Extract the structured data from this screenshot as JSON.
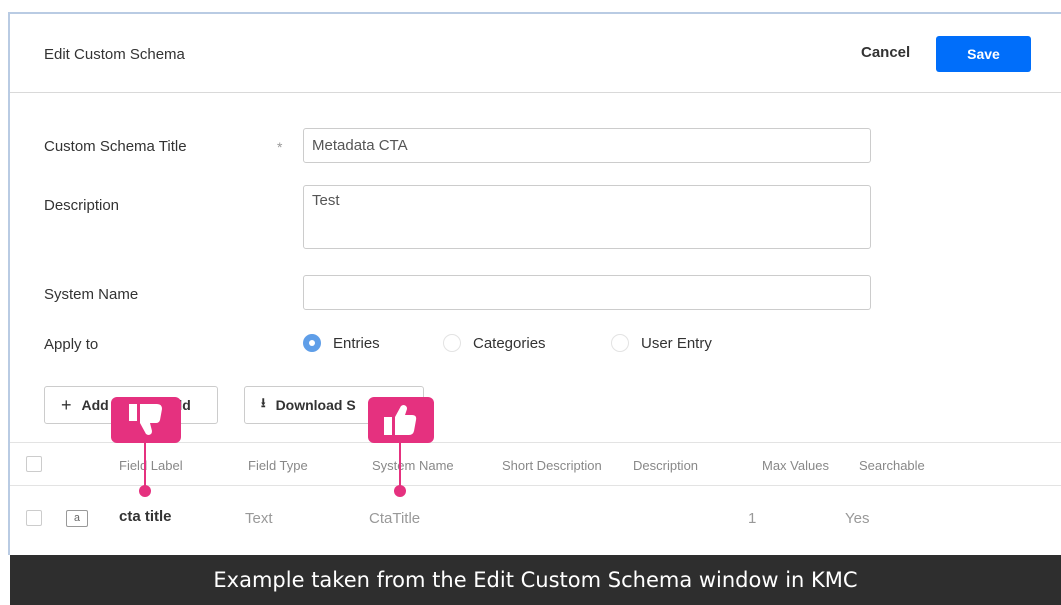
{
  "header": {
    "title": "Edit Custom Schema",
    "cancel_label": "Cancel",
    "save_label": "Save",
    "accent_color": "#006efa"
  },
  "form": {
    "title_label": "Custom Schema Title",
    "required_mark": "*",
    "title_value": "Metadata CTA",
    "description_label": "Description",
    "description_value": "Test",
    "system_name_label": "System Name",
    "system_name_value": "",
    "apply_to_label": "Apply to",
    "apply_to_options": [
      {
        "label": "Entries",
        "checked": true
      },
      {
        "label": "Categories",
        "checked": false
      },
      {
        "label": "User Entry",
        "checked": false
      }
    ]
  },
  "actions": {
    "add_field_icon": "plus-icon",
    "add_field_label_visible_start": "Add",
    "add_field_label_visible_end": "ield",
    "download_icon": "download-arrow-icon",
    "download_label_visible": "Download S"
  },
  "table": {
    "columns": [
      "Field Label",
      "Field Type",
      "System Name",
      "Short Description",
      "Description",
      "Max Values",
      "Searchable"
    ],
    "rows": [
      {
        "type_icon_text": "a",
        "field_label": "cta title",
        "field_type": "Text",
        "system_name": "CtaTitle",
        "short_description": "",
        "description": "",
        "max_values": "1",
        "searchable": "Yes"
      }
    ]
  },
  "annotations": {
    "thumbs_down_icon": "thumbs-down-icon",
    "thumbs_up_icon": "thumbs-up-icon",
    "badge_color": "#e5317f"
  },
  "caption": "Example taken from the Edit Custom Schema window in KMC"
}
